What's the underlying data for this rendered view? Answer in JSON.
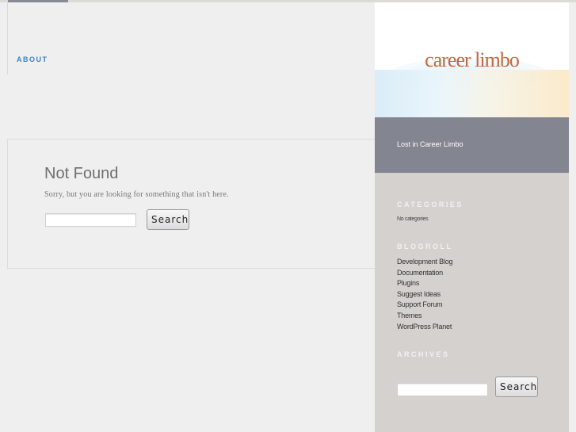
{
  "nav": {
    "items": [
      {
        "label": "ABOUT"
      }
    ]
  },
  "main": {
    "title": "Not Found",
    "message": "Sorry, but you are looking for something that isn't here.",
    "search": {
      "value": "",
      "button_label": "Search"
    }
  },
  "sidebar": {
    "site_title": "career limbo",
    "tagline": "Lost in Career Limbo",
    "categories": {
      "title": "CATEGORIES",
      "empty_text": "No categories"
    },
    "blogroll": {
      "title": "BLOGROLL",
      "links": [
        {
          "label": "Development Blog"
        },
        {
          "label": "Documentation"
        },
        {
          "label": "Plugins"
        },
        {
          "label": "Suggest Ideas"
        },
        {
          "label": "Support Forum"
        },
        {
          "label": "Themes"
        },
        {
          "label": "WordPress Planet"
        }
      ]
    },
    "archives": {
      "title": "ARCHIVES"
    },
    "search": {
      "value": "",
      "button_label": "Search"
    }
  },
  "colors": {
    "link_accent": "#3f7ec2",
    "title_accent": "#c4673a",
    "tagline_band": "#838590",
    "sidebar_bg": "#d4d1ce",
    "page_bg": "#efefef"
  }
}
